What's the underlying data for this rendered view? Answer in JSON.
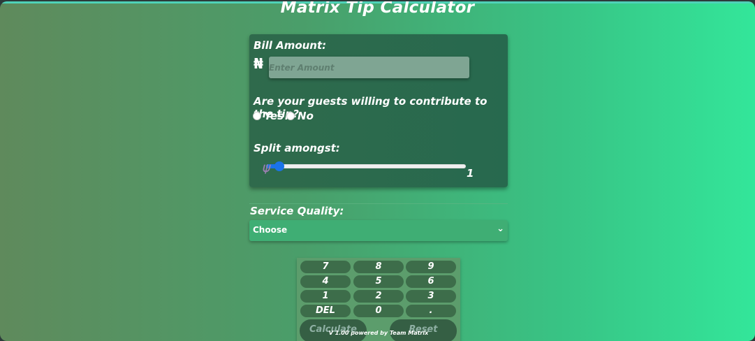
{
  "app": {
    "title": "Matrix Tip Calculator"
  },
  "bill": {
    "label": "Bill Amount:",
    "currency_symbol": "₦",
    "placeholder": "Enter Amount",
    "value": ""
  },
  "contribute": {
    "question": "Are your guests willing to contribute to the tip?",
    "options": [
      {
        "label": "Yes"
      },
      {
        "label": "No"
      }
    ]
  },
  "split": {
    "label": "Split amongst:",
    "value": "1"
  },
  "service": {
    "label": "Service Quality:",
    "selected": "Choose"
  },
  "keypad": {
    "keys": [
      "7",
      "8",
      "9",
      "4",
      "5",
      "6",
      "1",
      "2",
      "3",
      "DEL",
      "0",
      "."
    ],
    "calculate": "Calculate",
    "reset": "Reset"
  },
  "footer": {
    "text": "V 1.00 powered by Team Matrix"
  },
  "colors": {
    "accent": "#1a73e8",
    "card": "#2a6a4d",
    "key": "#3d6d4a"
  }
}
